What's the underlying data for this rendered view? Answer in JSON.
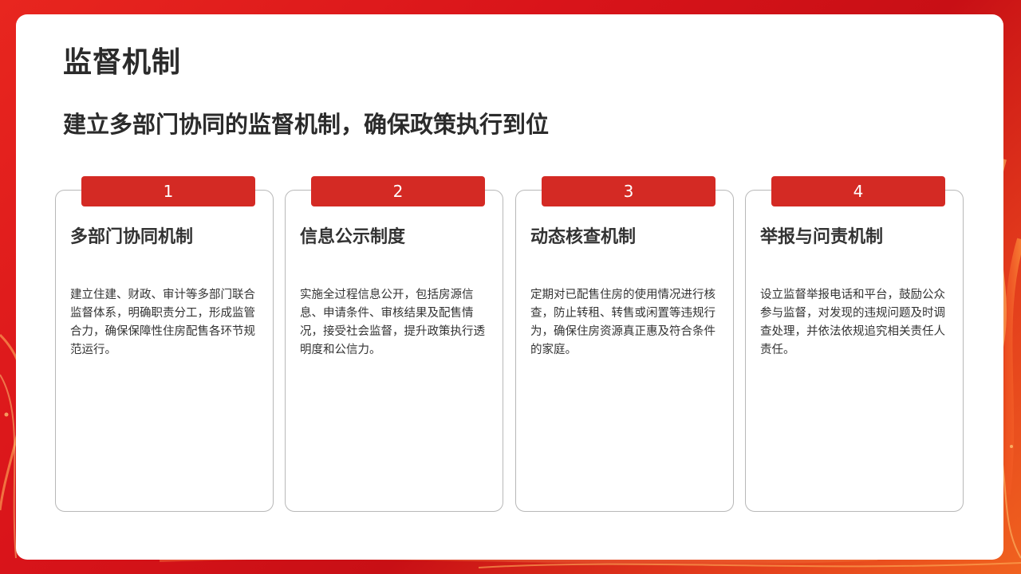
{
  "slide": {
    "title": "监督机制",
    "subtitle": "建立多部门协同的监督机制，确保政策执行到位"
  },
  "cards": [
    {
      "number": "1",
      "title": "多部门协同机制",
      "text": "建立住建、财政、审计等多部门联合监督体系，明确职责分工，形成监管合力，确保保障性住房配售各环节规范运行。"
    },
    {
      "number": "2",
      "title": "信息公示制度",
      "text": "实施全过程信息公开，包括房源信息、申请条件、审核结果及配售情况，接受社会监督，提升政策执行透明度和公信力。"
    },
    {
      "number": "3",
      "title": "动态核查机制",
      "text": "定期对已配售住房的使用情况进行核查，防止转租、转售或闲置等违规行为，确保住房资源真正惠及符合条件的家庭。"
    },
    {
      "number": "4",
      "title": "举报与问责机制",
      "text": "设立监督举报电话和平台，鼓励公众参与监督，对发现的违规问题及时调查处理，并依法依规追究相关责任人责任。"
    }
  ],
  "colors": {
    "accent": "#d42a24",
    "background_red": "#d9141a",
    "text_dark": "#2b2b2b",
    "card_border": "#b8b8b8"
  }
}
